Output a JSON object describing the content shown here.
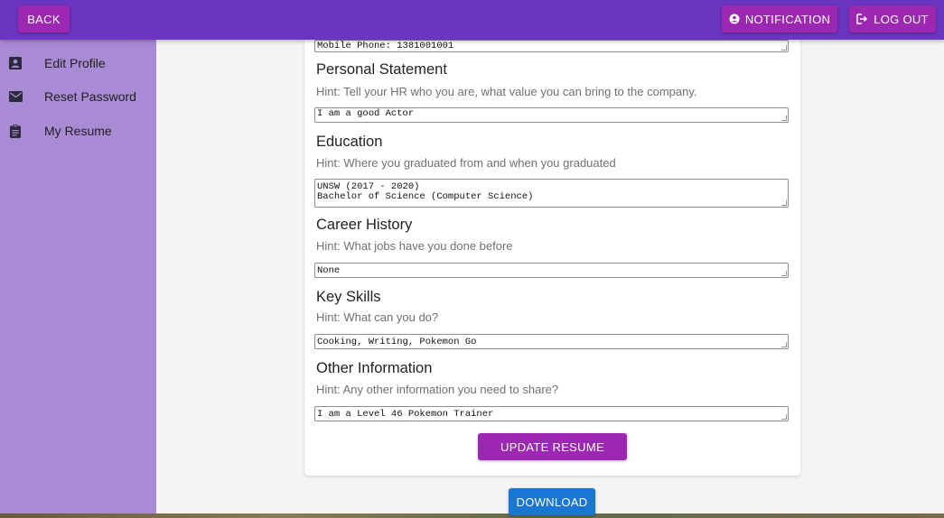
{
  "header": {
    "back_label": "BACK",
    "notification_label": "NOTIFICATION",
    "logout_label": "LOG OUT"
  },
  "sidebar": {
    "items": [
      {
        "label": "Edit Profile",
        "icon": "account-box-icon"
      },
      {
        "label": "Reset Password",
        "icon": "mail-icon"
      },
      {
        "label": "My Resume",
        "icon": "clipboard-icon"
      }
    ]
  },
  "resume": {
    "mobile_field": "Mobile Phone: 1381001001",
    "sections": [
      {
        "title": "Personal Statement",
        "hint": "Hint: Tell your HR who you are, what value you can bring to the company.",
        "value": "I am a good Actor"
      },
      {
        "title": "Education",
        "hint": "Hint: Where you graduated from and when you graduated",
        "value": "UNSW (2017 - 2020)\nBachelor of Science (Computer Science)"
      },
      {
        "title": "Career History",
        "hint": "Hint: What jobs have you done before",
        "value": "None"
      },
      {
        "title": "Key Skills",
        "hint": "Hint: What can you do?",
        "value": "Cooking, Writing, Pokemon Go"
      },
      {
        "title": "Other Information",
        "hint": "Hint: Any other information you need to share?",
        "value": "I am a Level 46 Pokemon Trainer"
      }
    ],
    "update_label": "UPDATE RESUME",
    "download_label": "DOWNLOAD"
  },
  "colors": {
    "appbar": "#6a35c0",
    "sidebar": "#a98bd5",
    "accent_button": "#9c27b0",
    "download_button": "#1976d2"
  }
}
